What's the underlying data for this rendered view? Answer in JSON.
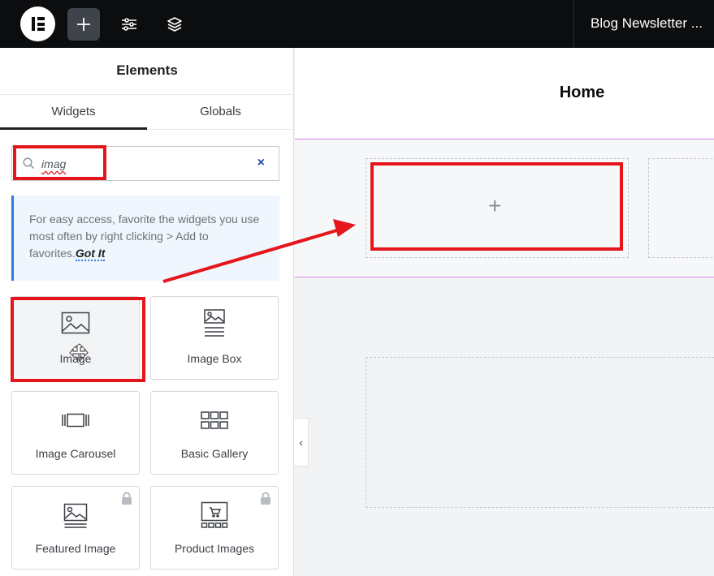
{
  "topbar": {
    "logo_icon": "elementor-logo-icon",
    "add_icon": "plus-icon",
    "settings_icon": "sliders-icon",
    "layers_icon": "layers-icon",
    "document_title": "Blog Newsletter ..."
  },
  "panel": {
    "title": "Elements",
    "tabs": [
      "Widgets",
      "Globals"
    ],
    "search": {
      "value": "imag",
      "clear": "×"
    },
    "tip": {
      "text": "For easy access, favorite the widgets you use most often by right clicking > Add to favorites.",
      "link": "Got It"
    },
    "widgets": [
      {
        "label": "Image",
        "icon": "image-icon",
        "locked": false
      },
      {
        "label": "Image Box",
        "icon": "image-box-icon",
        "locked": false
      },
      {
        "label": "Image Carousel",
        "icon": "image-carousel-icon",
        "locked": false
      },
      {
        "label": "Basic Gallery",
        "icon": "gallery-grid-icon",
        "locked": false
      },
      {
        "label": "Featured Image",
        "icon": "featured-image-icon",
        "locked": true
      },
      {
        "label": "Product Images",
        "icon": "product-images-icon",
        "locked": true
      }
    ]
  },
  "canvas": {
    "page_title": "Home",
    "add_widget": "+",
    "collapse": "‹"
  },
  "colors": {
    "highlight": "#e5151b",
    "section_outline": "#e28bf0",
    "accent": "#2e7ce6"
  }
}
